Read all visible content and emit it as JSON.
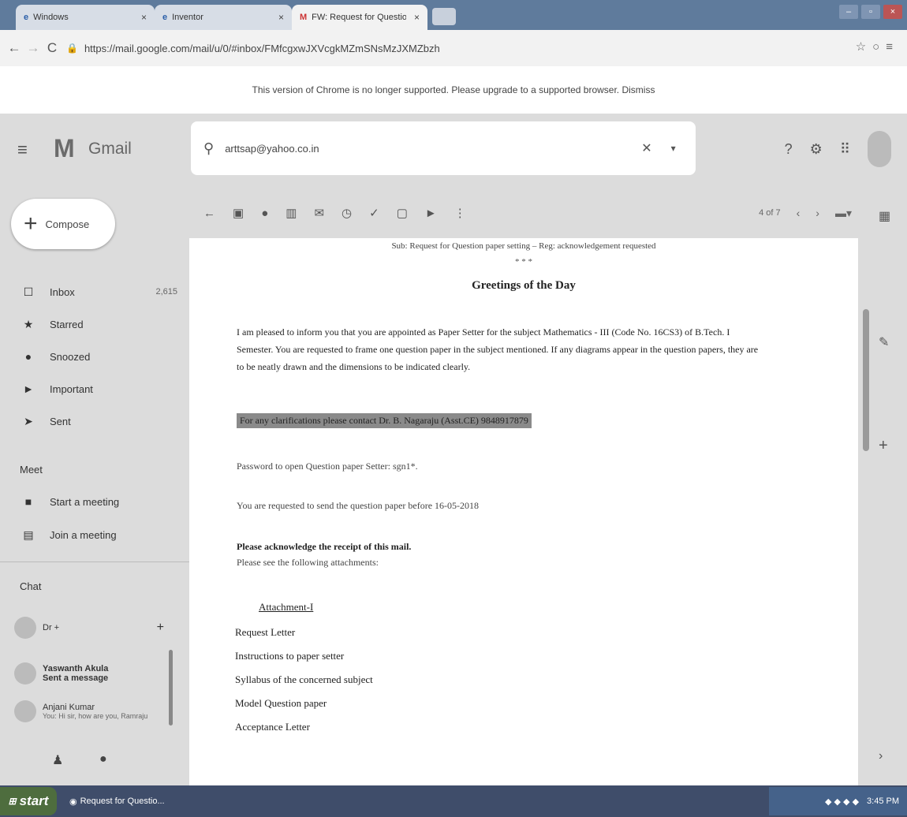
{
  "browser": {
    "tabs": [
      {
        "label": "Windows",
        "active": false
      },
      {
        "label": "Inventor",
        "active": false
      },
      {
        "label": "FW: Request for Question pape",
        "active": true
      }
    ],
    "url": "https://mail.google.com/mail/u/0/#inbox/FMfcgxwJXVcgkMZmSNsMzJXMZbzh",
    "infobar": "This version of Chrome is no longer supported. Please upgrade to a supported browser.   Dismiss"
  },
  "gmail": {
    "brand": "Gmail",
    "compose_label": "Compose",
    "search_value": "arttsap@yahoo.co.in",
    "nav": [
      {
        "label": "Inbox",
        "count": "2,615",
        "icon": "inbox-icon"
      },
      {
        "label": "Starred",
        "count": "",
        "icon": "star-icon"
      },
      {
        "label": "Snoozed",
        "count": "",
        "icon": "clock-icon"
      },
      {
        "label": "Important",
        "count": "",
        "icon": "important-icon"
      },
      {
        "label": "Sent",
        "count": "",
        "icon": "send-icon"
      }
    ],
    "meet_heading": "Meet",
    "meet": [
      {
        "label": "Start a meeting",
        "icon": "video-icon"
      },
      {
        "label": "Join a meeting",
        "icon": "keyboard-icon"
      }
    ],
    "chat_heading": "Chat",
    "chat_self": "Dr +",
    "chats": [
      {
        "name": "Yaswanth Akula",
        "status": "Sent a message"
      },
      {
        "name": "Anjani Kumar",
        "status": "You: Hi sir, how are you, Ramraju"
      }
    ],
    "pager": "4 of 7"
  },
  "message": {
    "subject_line": "Sub: Request for Question paper setting – Reg: acknowledgement requested",
    "stars": "* * *",
    "greeting": "Greetings of the Day",
    "para1": "I am pleased to inform you that you are appointed as Paper Setter for the subject Mathematics - III (Code No. 16CS3) of B.Tech. I",
    "para2": "Semester.  You are requested to frame one question paper in the subject mentioned. If any diagrams appear in the question papers, they are",
    "para3": "to be neatly drawn and the dimensions to be indicated clearly.",
    "highlight": "For any clarifications please contact Dr. B. Nagaraju (Asst.CE) 9848917879",
    "password": "Password to open Question paper Setter: sgn1*.",
    "deadline": "You are requested to send the question paper before 16-05-2018",
    "ack": "Please acknowledge the receipt of this mail.",
    "see": "Please see the following attachments:",
    "attachment_heading": "Attachment-I",
    "attachments": [
      "Request Letter",
      "Instructions to paper setter",
      "Syllabus of the concerned subject",
      "Model Question paper",
      "Acceptance Letter"
    ]
  },
  "taskbar": {
    "start": "start",
    "task": "Request for Questio...",
    "clock": "3:45 PM"
  }
}
